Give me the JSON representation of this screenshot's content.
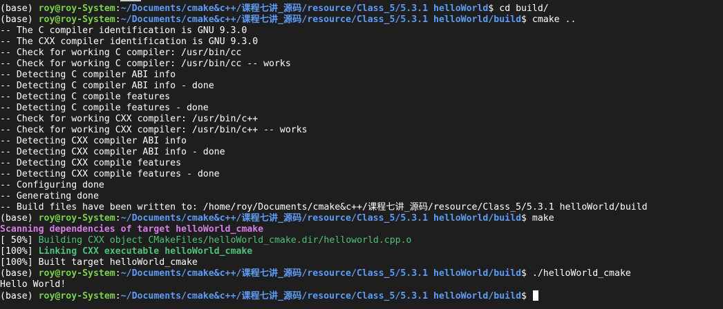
{
  "terminal": {
    "lines": [
      {
        "type": "prompt",
        "env": "(base) ",
        "user": "roy@roy-System",
        "sep": ":",
        "path": "~/Documents/cmake&c++/课程七讲_源码/resource/Class_5/5.3.1 helloWorld",
        "end": "$ ",
        "cmd": "cd build/"
      },
      {
        "type": "prompt",
        "env": "(base) ",
        "user": "roy@roy-System",
        "sep": ":",
        "path": "~/Documents/cmake&c++/课程七讲_源码/resource/Class_5/5.3.1 helloWorld/build",
        "end": "$ ",
        "cmd": "cmake .."
      },
      {
        "type": "output",
        "text": "-- The C compiler identification is GNU 9.3.0"
      },
      {
        "type": "output",
        "text": "-- The CXX compiler identification is GNU 9.3.0"
      },
      {
        "type": "output",
        "text": "-- Check for working C compiler: /usr/bin/cc"
      },
      {
        "type": "output",
        "text": "-- Check for working C compiler: /usr/bin/cc -- works"
      },
      {
        "type": "output",
        "text": "-- Detecting C compiler ABI info"
      },
      {
        "type": "output",
        "text": "-- Detecting C compiler ABI info - done"
      },
      {
        "type": "output",
        "text": "-- Detecting C compile features"
      },
      {
        "type": "output",
        "text": "-- Detecting C compile features - done"
      },
      {
        "type": "output",
        "text": "-- Check for working CXX compiler: /usr/bin/c++"
      },
      {
        "type": "output",
        "text": "-- Check for working CXX compiler: /usr/bin/c++ -- works"
      },
      {
        "type": "output",
        "text": "-- Detecting CXX compiler ABI info"
      },
      {
        "type": "output",
        "text": "-- Detecting CXX compiler ABI info - done"
      },
      {
        "type": "output",
        "text": "-- Detecting CXX compile features"
      },
      {
        "type": "output",
        "text": "-- Detecting CXX compile features - done"
      },
      {
        "type": "output",
        "text": "-- Configuring done"
      },
      {
        "type": "output",
        "text": "-- Generating done"
      },
      {
        "type": "output",
        "text": "-- Build files have been written to: /home/roy/Documents/cmake&c++/课程七讲_源码/resource/Class_5/5.3.1 helloWorld/build"
      },
      {
        "type": "prompt",
        "env": "(base) ",
        "user": "roy@roy-System",
        "sep": ":",
        "path": "~/Documents/cmake&c++/课程七讲_源码/resource/Class_5/5.3.1 helloWorld/build",
        "end": "$ ",
        "cmd": "make"
      },
      {
        "type": "magenta",
        "text": "Scanning dependencies of target helloWorld_cmake"
      },
      {
        "type": "progress",
        "prefix": "[ 50%] ",
        "text": "Building CXX object CMakeFiles/helloWorld_cmake.dir/helloworld.cpp.o",
        "style": "green"
      },
      {
        "type": "progress",
        "prefix": "[100%] ",
        "text": "Linking CXX executable helloWorld_cmake",
        "style": "green-bold"
      },
      {
        "type": "output",
        "text": "[100%] Built target helloWorld_cmake"
      },
      {
        "type": "prompt",
        "env": "(base) ",
        "user": "roy@roy-System",
        "sep": ":",
        "path": "~/Documents/cmake&c++/课程七讲_源码/resource/Class_5/5.3.1 helloWorld/build",
        "end": "$ ",
        "cmd": "./helloWorld_cmake"
      },
      {
        "type": "output",
        "text": "Hello World!"
      },
      {
        "type": "prompt",
        "env": "(base) ",
        "user": "roy@roy-System",
        "sep": ":",
        "path": "~/Documents/cmake&c++/课程七讲_源码/resource/Class_5/5.3.1 helloWorld/build",
        "end": "$ ",
        "cmd": "",
        "cursor": true
      }
    ]
  },
  "colors": {
    "background": "#1e1e1e",
    "user": "#7bd34a",
    "path": "#5c9cf5",
    "magenta": "#d77ee6",
    "green": "#4ec27a",
    "text": "#ffffff"
  }
}
